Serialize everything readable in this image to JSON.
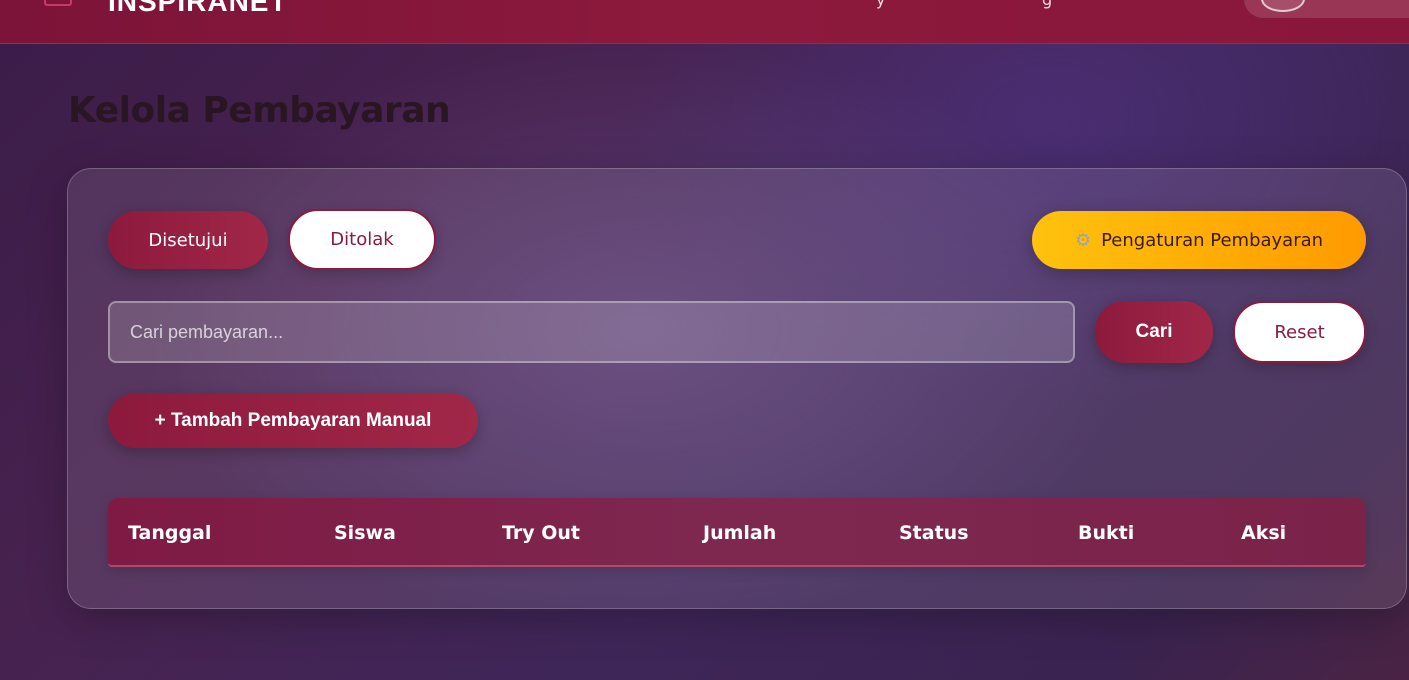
{
  "topbar": {
    "brand": "INSPIRANET",
    "nav_fragment_1": "y",
    "nav_fragment_2": "g"
  },
  "page": {
    "title": "Kelola Pembayaran"
  },
  "filters": {
    "tabs": [
      {
        "label": "Disetujui",
        "active": true
      },
      {
        "label": "Ditolak",
        "active": false
      }
    ],
    "settings_label": "Pengaturan Pembayaran",
    "settings_icon": "gear-icon"
  },
  "search": {
    "placeholder": "Cari pembayaran...",
    "value": "",
    "search_label": "Cari",
    "reset_label": "Reset"
  },
  "actions": {
    "add_manual_label": "+ Tambah Pembayaran Manual"
  },
  "table": {
    "columns": [
      "Tanggal",
      "Siswa",
      "Try Out",
      "Jumlah",
      "Status",
      "Bukti",
      "Aksi"
    ],
    "rows": []
  },
  "colors": {
    "primary": "#8c1a3d",
    "accent_gold": "#ffc20d",
    "accent_orange": "#ff9a00"
  }
}
